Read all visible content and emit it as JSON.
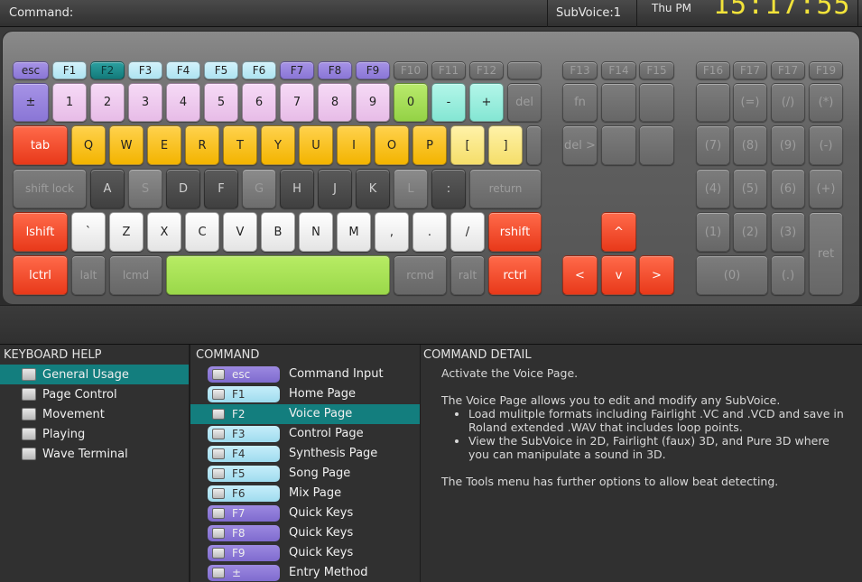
{
  "topbar": {
    "command_label": "Command:",
    "subvoice": "SubVoice:1",
    "day": "Thu PM",
    "clock": "15:17:55"
  },
  "keyboard": {
    "fn_row": [
      "esc",
      "F1",
      "F2",
      "F3",
      "F4",
      "F5",
      "F6",
      "F7",
      "F8",
      "F9",
      "F10",
      "F11",
      "F12",
      "",
      "F13",
      "F14",
      "F15",
      "F16",
      "F17",
      "F17",
      "F19"
    ],
    "num_row": [
      "±",
      "1",
      "2",
      "3",
      "4",
      "5",
      "6",
      "7",
      "8",
      "9",
      "0",
      "-",
      "+",
      "del"
    ],
    "q_row": [
      "tab",
      "Q",
      "W",
      "E",
      "R",
      "T",
      "Y",
      "U",
      "I",
      "O",
      "P",
      "[",
      "]"
    ],
    "a_row": [
      "shift lock",
      "A",
      "S",
      "D",
      "F",
      "G",
      "H",
      "J",
      "K",
      "L",
      ":",
      "return"
    ],
    "z_row": [
      "lshift",
      "`",
      "Z",
      "X",
      "C",
      "V",
      "B",
      "N",
      "M",
      ",",
      ".",
      "/",
      "rshift"
    ],
    "bottom_row": [
      "lctrl",
      "lalt",
      "lcmd",
      "",
      "rcmd",
      "ralt",
      "rctrl"
    ],
    "nav": [
      "fn",
      "del >",
      "^",
      "<",
      "v",
      ">"
    ],
    "numpad": [
      "(=)",
      "(/)",
      "(*)",
      "(7)",
      "(8)",
      "(9)",
      "(-)",
      "(4)",
      "(5)",
      "(6)",
      "(+)",
      "(1)",
      "(2)",
      "(3)",
      "ret",
      "(0)",
      "(.)"
    ]
  },
  "help": {
    "header": "KEYBOARD HELP",
    "items": [
      "General Usage",
      "Page Control",
      "Movement",
      "Playing",
      "Wave Terminal"
    ],
    "selected": 0
  },
  "command": {
    "header": "COMMAND",
    "items": [
      {
        "key": "esc",
        "desc": "Command Input",
        "color": "purple"
      },
      {
        "key": "F1",
        "desc": "Home Page",
        "color": "lightblue"
      },
      {
        "key": "F2",
        "desc": "Voice Page",
        "color": "selected"
      },
      {
        "key": "F3",
        "desc": "Control Page",
        "color": "lightblue"
      },
      {
        "key": "F4",
        "desc": "Synthesis Page",
        "color": "lightblue"
      },
      {
        "key": "F5",
        "desc": "Song Page",
        "color": "lightblue"
      },
      {
        "key": "F6",
        "desc": "Mix Page",
        "color": "lightblue"
      },
      {
        "key": "F7",
        "desc": "Quick Keys",
        "color": "purple"
      },
      {
        "key": "F8",
        "desc": "Quick Keys",
        "color": "purple"
      },
      {
        "key": "F9",
        "desc": "Quick Keys",
        "color": "purple"
      },
      {
        "key": "±",
        "desc": "Entry Method",
        "color": "purple"
      }
    ]
  },
  "detail": {
    "header": "COMMAND DETAIL",
    "line1": "Activate the Voice Page.",
    "line2": "The Voice Page allows you to edit and modify any SubVoice.",
    "bullet1": "Load mulitple formats including Fairlight .VC and .VCD and save in Roland extended .WAV that includes loop points.",
    "bullet2": "View the SubVoice in 2D, Fairlight (faux) 3D, and Pure 3D where you can manipulate a sound in 3D.",
    "line3": "The Tools menu has further options to allow beat detecting."
  }
}
